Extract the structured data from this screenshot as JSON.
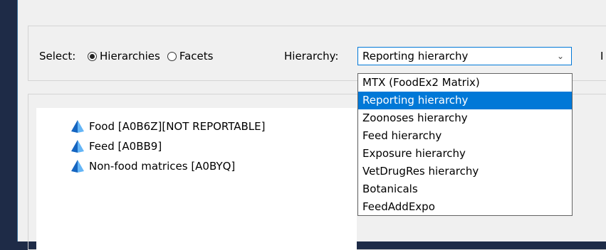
{
  "select_row": {
    "label": "Select:",
    "radio_hierarchies": "Hierarchies",
    "radio_facets": "Facets",
    "selected": "Hierarchies"
  },
  "hierarchy": {
    "label": "Hierarchy:",
    "value": "Reporting hierarchy",
    "options": [
      "MTX (FoodEx2 Matrix)",
      "Reporting hierarchy",
      "Zoonoses hierarchy",
      "Feed hierarchy",
      "Exposure hierarchy",
      "VetDrugRes hierarchy",
      "Botanicals",
      "FeedAddExpo"
    ],
    "selected_index": 1
  },
  "edge_char": "I",
  "tree": {
    "items": [
      {
        "label": "Food [A0B6Z][NOT REPORTABLE]",
        "icon": "pyramid-icon"
      },
      {
        "label": "Feed [A0BB9]",
        "icon": "pyramid-icon"
      },
      {
        "label": "Non-food matrices [A0BYQ]",
        "icon": "pyramid-icon"
      }
    ]
  },
  "colors": {
    "accent": "#0078d7",
    "window_bg": "#f0f0f0",
    "desktop_bg": "#1e2b47",
    "pyramid_dark": "#1565c0",
    "pyramid_light": "#64b5f6"
  }
}
